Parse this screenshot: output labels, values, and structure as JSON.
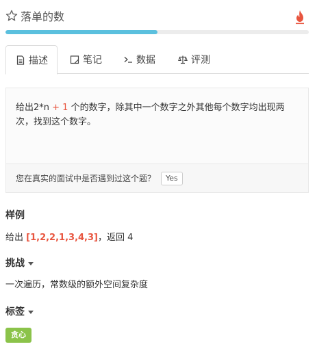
{
  "header": {
    "title": "落单的数"
  },
  "progress": {
    "fraction": 0.5
  },
  "tabs": [
    {
      "label": "描述",
      "icon": "document-icon"
    },
    {
      "label": "笔记",
      "icon": "note-icon"
    },
    {
      "label": "数据",
      "icon": "terminal-icon"
    },
    {
      "label": "评测",
      "icon": "scale-icon"
    }
  ],
  "description": {
    "part1": "给出2*n",
    "part2": " + 1",
    "part3": " 个的数字，除其中一个数字之外其他每个数字均出现两次，找到这个数字。"
  },
  "interview": {
    "question": "您在真实的面试中是否遇到过这个题？",
    "yes_label": "Yes"
  },
  "example": {
    "title": "样例",
    "prefix": "给出 ",
    "array": "[1,2,2,1,3,4,3]",
    "suffix": "，返回 4"
  },
  "challenge": {
    "title": "挑战",
    "text": "一次遍历，常数级的额外空间复杂度"
  },
  "tags_section": {
    "title": "标签",
    "tags": [
      "贪心"
    ]
  },
  "colors": {
    "progress": "#5bc0de",
    "highlight": "#e8553f",
    "tag": "#8bc34a"
  }
}
